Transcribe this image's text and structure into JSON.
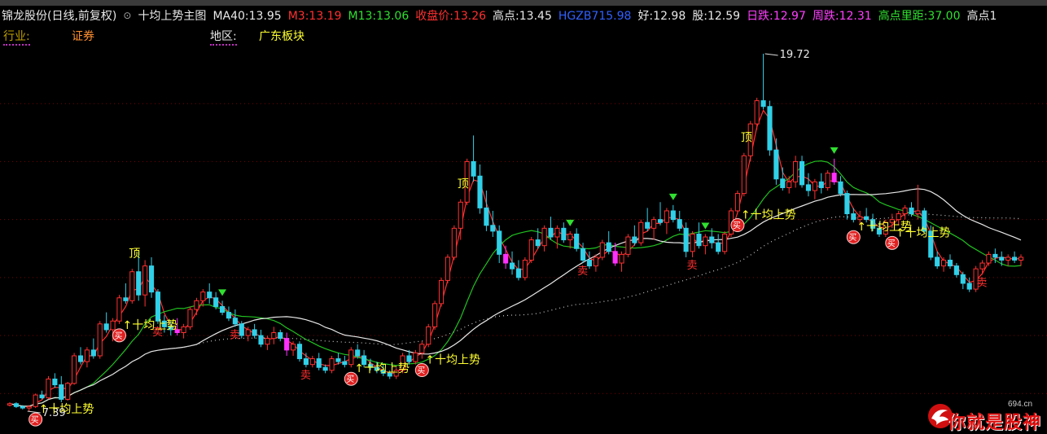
{
  "header": {
    "stock": "锦龙股份(日线,前复权)",
    "indicator": "十均上势主图",
    "fields": [
      {
        "label": "MA40:",
        "value": "13.95",
        "label_color": "#e8e8e8",
        "value_color": "#e8e8e8"
      },
      {
        "label": "M3:",
        "value": "13.19",
        "label_color": "#ff3030",
        "value_color": "#ff3030"
      },
      {
        "label": "M13:",
        "value": "13.06",
        "label_color": "#30e030",
        "value_color": "#30e030"
      },
      {
        "label": "收盘价:",
        "value": "13.26",
        "label_color": "#ff3030",
        "value_color": "#ff3030"
      },
      {
        "label": "高点:",
        "value": "13.45",
        "label_color": "#e8e8e8",
        "value_color": "#e8e8e8"
      },
      {
        "label": "HGZB7",
        "value": "15.98",
        "label_color": "#3060ff",
        "value_color": "#3060ff"
      },
      {
        "label": "好:",
        "value": "12.98",
        "label_color": "#e8e8e8",
        "value_color": "#e8e8e8"
      },
      {
        "label": "股:",
        "value": "12.59",
        "label_color": "#e8e8e8",
        "value_color": "#e8e8e8"
      },
      {
        "label": "日跌:",
        "value": "12.97",
        "label_color": "#ff40ff",
        "value_color": "#ff40ff"
      },
      {
        "label": "周跌:",
        "value": "12.31",
        "label_color": "#ff40ff",
        "value_color": "#ff40ff"
      },
      {
        "label": "高点里距:",
        "value": "37.00",
        "label_color": "#30e030",
        "value_color": "#30e030"
      },
      {
        "label": "高点",
        "value": "1",
        "label_color": "#e8e8e8",
        "value_color": "#e8e8e8"
      }
    ]
  },
  "subheader": {
    "industry_label": "行业:",
    "industry_value": "证券",
    "region_label": "地区:",
    "region_value": "广东板块"
  },
  "watermark": {
    "url": "694.cn",
    "text": "你就是股神"
  },
  "chart_data": {
    "type": "candlestick",
    "title": "",
    "ylim": [
      6.8,
      20.0
    ],
    "grid": true,
    "annotations": {
      "high_label": "19.72",
      "low_label": "7.39",
      "top_label": "顶",
      "signal_label": "十均上势",
      "buy_label": "买",
      "sell_label": "卖"
    },
    "candles": [
      [
        7.6,
        7.7,
        7.55,
        7.65
      ],
      [
        7.65,
        7.7,
        7.5,
        7.55
      ],
      [
        7.55,
        7.6,
        7.45,
        7.5
      ],
      [
        7.5,
        7.6,
        7.39,
        7.55
      ],
      [
        7.55,
        8.0,
        7.5,
        7.95
      ],
      [
        7.95,
        8.1,
        7.8,
        7.85
      ],
      [
        7.85,
        8.6,
        7.8,
        8.5
      ],
      [
        8.5,
        8.7,
        8.2,
        8.3
      ],
      [
        8.3,
        8.6,
        7.7,
        7.8
      ],
      [
        7.8,
        8.4,
        7.75,
        8.35
      ],
      [
        8.35,
        9.4,
        8.3,
        9.3
      ],
      [
        9.3,
        9.6,
        9.0,
        9.1
      ],
      [
        9.1,
        9.6,
        8.9,
        9.5
      ],
      [
        9.5,
        9.9,
        9.2,
        9.3
      ],
      [
        9.3,
        10.5,
        9.2,
        10.4
      ],
      [
        10.4,
        10.8,
        10.1,
        10.2
      ],
      [
        10.2,
        10.6,
        9.8,
        10.5
      ],
      [
        10.5,
        11.4,
        10.4,
        11.3
      ],
      [
        11.3,
        11.8,
        11.1,
        11.2
      ],
      [
        11.2,
        12.3,
        11.1,
        12.2
      ],
      [
        12.2,
        12.9,
        11.2,
        11.4
      ],
      [
        11.4,
        12.6,
        11.0,
        12.4
      ],
      [
        12.4,
        12.7,
        11.3,
        11.5
      ],
      [
        11.5,
        11.6,
        10.4,
        10.5
      ],
      [
        10.5,
        10.7,
        10.1,
        10.3
      ],
      [
        10.3,
        10.5,
        10.0,
        10.2
      ],
      [
        10.2,
        10.6,
        10.0,
        10.1
      ],
      [
        10.1,
        10.4,
        9.9,
        10.3
      ],
      [
        10.3,
        11.0,
        10.2,
        10.9
      ],
      [
        10.9,
        11.3,
        10.7,
        11.2
      ],
      [
        11.2,
        11.6,
        11.0,
        11.5
      ],
      [
        11.5,
        11.8,
        11.1,
        11.3
      ],
      [
        11.3,
        11.5,
        10.9,
        11.0
      ],
      [
        11.0,
        11.2,
        10.7,
        10.8
      ],
      [
        10.8,
        11.0,
        10.5,
        10.6
      ],
      [
        10.6,
        10.9,
        10.3,
        10.4
      ],
      [
        10.4,
        10.5,
        9.9,
        10.0
      ],
      [
        10.0,
        10.3,
        9.8,
        10.2
      ],
      [
        10.2,
        10.4,
        9.9,
        10.0
      ],
      [
        10.0,
        10.2,
        9.6,
        9.7
      ],
      [
        9.7,
        10.0,
        9.5,
        9.9
      ],
      [
        9.9,
        10.3,
        9.7,
        10.1
      ],
      [
        10.1,
        10.2,
        9.8,
        9.9
      ],
      [
        9.9,
        10.1,
        9.3,
        9.5
      ],
      [
        9.5,
        9.8,
        9.3,
        9.7
      ],
      [
        9.7,
        9.8,
        9.1,
        9.2
      ],
      [
        9.2,
        9.4,
        8.9,
        9.0
      ],
      [
        9.0,
        9.3,
        8.9,
        9.2
      ],
      [
        9.2,
        9.4,
        8.8,
        8.9
      ],
      [
        8.9,
        9.0,
        8.7,
        8.8
      ],
      [
        8.8,
        9.3,
        8.7,
        9.2
      ],
      [
        9.2,
        9.4,
        9.0,
        9.1
      ],
      [
        9.1,
        9.3,
        8.9,
        9.0
      ],
      [
        9.0,
        9.6,
        8.9,
        9.5
      ],
      [
        9.5,
        9.7,
        9.2,
        9.3
      ],
      [
        9.3,
        9.5,
        8.9,
        9.0
      ],
      [
        9.0,
        9.2,
        8.8,
        8.9
      ],
      [
        8.9,
        9.1,
        8.7,
        8.8
      ],
      [
        8.8,
        9.0,
        8.6,
        8.7
      ],
      [
        8.7,
        8.8,
        8.5,
        8.6
      ],
      [
        8.6,
        8.9,
        8.5,
        8.8
      ],
      [
        8.8,
        9.4,
        8.7,
        9.3
      ],
      [
        9.3,
        9.5,
        9.0,
        9.1
      ],
      [
        9.1,
        9.5,
        9.0,
        9.4
      ],
      [
        9.4,
        9.8,
        9.2,
        9.7
      ],
      [
        9.7,
        10.4,
        9.6,
        10.3
      ],
      [
        10.3,
        11.2,
        10.2,
        11.1
      ],
      [
        11.1,
        12.0,
        11.0,
        11.9
      ],
      [
        11.9,
        12.8,
        11.8,
        12.7
      ],
      [
        12.7,
        13.8,
        12.6,
        13.7
      ],
      [
        13.7,
        14.7,
        13.3,
        14.6
      ],
      [
        14.6,
        16.1,
        14.5,
        16.0
      ],
      [
        16.0,
        16.9,
        15.3,
        15.5
      ],
      [
        15.5,
        15.9,
        14.2,
        14.4
      ],
      [
        14.4,
        15.0,
        13.6,
        13.8
      ],
      [
        13.8,
        14.3,
        13.4,
        13.6
      ],
      [
        13.6,
        13.8,
        12.5,
        12.8
      ],
      [
        12.8,
        13.1,
        12.3,
        12.5
      ],
      [
        12.5,
        12.9,
        12.1,
        12.3
      ],
      [
        12.3,
        12.6,
        11.9,
        12.0
      ],
      [
        12.0,
        12.7,
        11.9,
        12.6
      ],
      [
        12.6,
        13.4,
        12.5,
        13.3
      ],
      [
        13.3,
        13.7,
        13.0,
        13.1
      ],
      [
        13.1,
        13.8,
        12.9,
        13.7
      ],
      [
        13.7,
        14.1,
        13.3,
        13.4
      ],
      [
        13.4,
        13.8,
        13.0,
        13.7
      ],
      [
        13.7,
        13.9,
        13.2,
        13.3
      ],
      [
        13.3,
        13.6,
        13.0,
        13.5
      ],
      [
        13.5,
        13.7,
        12.9,
        13.0
      ],
      [
        13.0,
        13.2,
        12.5,
        12.6
      ],
      [
        12.6,
        12.9,
        12.3,
        12.4
      ],
      [
        12.4,
        12.8,
        12.2,
        12.7
      ],
      [
        12.7,
        13.3,
        12.6,
        13.2
      ],
      [
        13.2,
        13.6,
        12.8,
        12.9
      ],
      [
        12.9,
        13.2,
        12.4,
        12.5
      ],
      [
        12.5,
        12.9,
        12.2,
        12.8
      ],
      [
        12.8,
        13.5,
        12.7,
        13.4
      ],
      [
        13.4,
        13.8,
        13.1,
        13.2
      ],
      [
        13.2,
        14.0,
        13.1,
        13.9
      ],
      [
        13.9,
        14.4,
        13.6,
        13.7
      ],
      [
        13.7,
        14.1,
        13.3,
        14.0
      ],
      [
        14.0,
        14.6,
        13.8,
        13.9
      ],
      [
        13.9,
        14.4,
        13.5,
        14.3
      ],
      [
        14.3,
        14.5,
        13.9,
        14.0
      ],
      [
        14.0,
        14.3,
        13.6,
        13.7
      ],
      [
        13.7,
        13.9,
        12.7,
        12.9
      ],
      [
        12.9,
        13.6,
        12.7,
        13.5
      ],
      [
        13.5,
        13.9,
        13.0,
        13.1
      ],
      [
        13.1,
        13.5,
        12.8,
        13.4
      ],
      [
        13.4,
        13.7,
        13.0,
        13.2
      ],
      [
        13.2,
        13.5,
        12.8,
        12.9
      ],
      [
        12.9,
        13.6,
        12.8,
        13.5
      ],
      [
        13.5,
        14.4,
        13.4,
        14.3
      ],
      [
        14.3,
        15.0,
        14.2,
        14.9
      ],
      [
        14.9,
        16.3,
        14.8,
        16.2
      ],
      [
        16.2,
        17.4,
        16.0,
        17.3
      ],
      [
        17.3,
        18.2,
        17.1,
        18.1
      ],
      [
        18.1,
        19.72,
        17.8,
        17.9
      ],
      [
        17.9,
        18.1,
        16.2,
        16.4
      ],
      [
        16.4,
        16.8,
        15.2,
        15.4
      ],
      [
        15.4,
        15.8,
        15.0,
        15.1
      ],
      [
        15.1,
        15.5,
        14.9,
        15.3
      ],
      [
        15.3,
        16.2,
        15.1,
        16.0
      ],
      [
        16.0,
        16.2,
        15.1,
        15.2
      ],
      [
        15.2,
        15.6,
        14.8,
        15.0
      ],
      [
        15.0,
        15.4,
        14.7,
        15.3
      ],
      [
        15.3,
        15.6,
        14.9,
        15.1
      ],
      [
        15.1,
        15.7,
        15.0,
        15.6
      ],
      [
        15.6,
        16.1,
        15.2,
        15.3
      ],
      [
        15.3,
        15.5,
        14.8,
        14.9
      ],
      [
        14.9,
        15.0,
        14.0,
        14.2
      ],
      [
        14.2,
        14.4,
        13.9,
        14.0
      ],
      [
        14.0,
        14.3,
        13.8,
        14.1
      ],
      [
        14.1,
        14.4,
        13.9,
        14.0
      ],
      [
        14.0,
        14.2,
        13.6,
        13.7
      ],
      [
        13.7,
        13.9,
        13.4,
        13.5
      ],
      [
        13.5,
        14.0,
        13.4,
        13.9
      ],
      [
        13.9,
        14.2,
        13.7,
        14.0
      ],
      [
        14.0,
        14.3,
        13.8,
        14.2
      ],
      [
        14.2,
        14.5,
        14.0,
        14.4
      ],
      [
        14.4,
        14.6,
        14.1,
        14.2
      ],
      [
        14.2,
        15.2,
        14.0,
        14.3
      ],
      [
        14.3,
        14.4,
        13.5,
        13.6
      ],
      [
        13.6,
        13.8,
        12.6,
        12.7
      ],
      [
        12.7,
        12.9,
        12.3,
        12.4
      ],
      [
        12.4,
        12.7,
        12.2,
        12.6
      ],
      [
        12.6,
        12.8,
        12.3,
        12.4
      ],
      [
        12.4,
        12.5,
        12.0,
        12.1
      ],
      [
        12.1,
        12.2,
        11.6,
        11.8
      ],
      [
        11.8,
        12.0,
        11.5,
        11.6
      ],
      [
        11.6,
        12.4,
        11.5,
        12.3
      ],
      [
        12.3,
        12.6,
        12.1,
        12.5
      ],
      [
        12.5,
        12.9,
        12.4,
        12.8
      ],
      [
        12.8,
        13.0,
        12.5,
        12.7
      ],
      [
        12.7,
        12.9,
        12.4,
        12.6
      ],
      [
        12.6,
        12.8,
        12.4,
        12.7
      ],
      [
        12.7,
        12.9,
        12.5,
        12.6
      ],
      [
        12.6,
        12.8,
        12.4,
        12.7
      ]
    ]
  }
}
